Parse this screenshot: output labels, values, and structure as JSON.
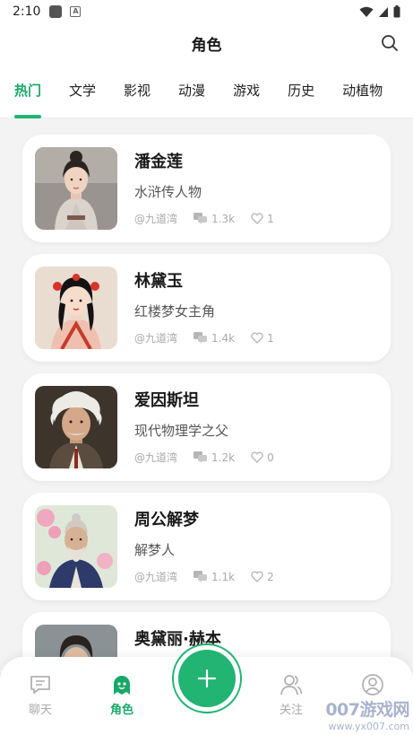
{
  "status_bar": {
    "time": "2:10",
    "a_icon_letter": "A"
  },
  "header": {
    "title": "角色"
  },
  "tabs": [
    {
      "label": "热门",
      "active": true
    },
    {
      "label": "文学",
      "active": false
    },
    {
      "label": "影视",
      "active": false
    },
    {
      "label": "动漫",
      "active": false
    },
    {
      "label": "游戏",
      "active": false
    },
    {
      "label": "历史",
      "active": false
    },
    {
      "label": "动植物",
      "active": false
    }
  ],
  "cards": [
    {
      "name": "潘金莲",
      "desc": "水浒传人物",
      "author": "@九道湾",
      "chats": "1.3k",
      "likes": "1",
      "avatar": "woman-in-gray-robe-portrait"
    },
    {
      "name": "林黛玉",
      "desc": "红楼梦女主角",
      "author": "@九道湾",
      "chats": "1.4k",
      "likes": "1",
      "avatar": "woman-with-red-flowers-portrait"
    },
    {
      "name": "爱因斯坦",
      "desc": "现代物理学之父",
      "author": "@九道湾",
      "chats": "1.2k",
      "likes": "0",
      "avatar": "white-haired-old-man-portrait"
    },
    {
      "name": "周公解梦",
      "desc": "解梦人",
      "author": "@九道湾",
      "chats": "1.1k",
      "likes": "2",
      "avatar": "bearded-sage-with-blossoms-portrait"
    },
    {
      "name": "奥黛丽·赫本",
      "desc": "",
      "author": "",
      "chats": "",
      "likes": "",
      "avatar": "dark-haired-person-portrait"
    }
  ],
  "bottom_nav": [
    {
      "label": "聊天",
      "icon": "chat-bubble-icon",
      "active": false
    },
    {
      "label": "角色",
      "icon": "ghost-character-icon",
      "active": true
    },
    {
      "label": "关注",
      "icon": "people-icon",
      "active": false
    },
    {
      "label": "",
      "icon": "user-circle-icon",
      "active": false
    }
  ],
  "fab": {
    "icon": "plus-icon"
  },
  "watermark": {
    "line1": "007游戏网",
    "line2": "www.yx007.com"
  },
  "colors": {
    "accent": "#22b472",
    "background": "#f3f3f3",
    "muted": "#aaaaaa"
  }
}
